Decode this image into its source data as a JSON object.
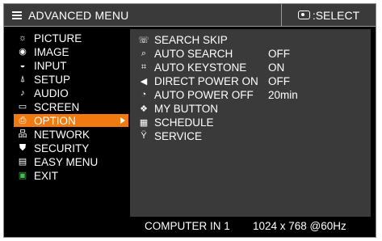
{
  "header": {
    "title": "ADVANCED MENU",
    "select_hint": ":SELECT"
  },
  "left_menu": [
    {
      "label": "PICTURE",
      "icon": "picture-icon",
      "active": false
    },
    {
      "label": "IMAGE",
      "icon": "image-icon",
      "active": false
    },
    {
      "label": "INPUT",
      "icon": "input-icon",
      "active": false
    },
    {
      "label": "SETUP",
      "icon": "setup-icon",
      "active": false
    },
    {
      "label": "AUDIO",
      "icon": "audio-icon",
      "active": false
    },
    {
      "label": "SCREEN",
      "icon": "screen-icon",
      "active": false
    },
    {
      "label": "OPTION",
      "icon": "option-icon",
      "active": true
    },
    {
      "label": "NETWORK",
      "icon": "network-icon",
      "active": false
    },
    {
      "label": "SECURITY",
      "icon": "security-icon",
      "active": false
    },
    {
      "label": "EASY MENU",
      "icon": "easy-menu-icon",
      "active": false
    },
    {
      "label": "EXIT",
      "icon": "exit-icon",
      "active": false
    }
  ],
  "option_items": [
    {
      "label": "SEARCH SKIP",
      "value": "",
      "icon": "search-skip-icon"
    },
    {
      "label": "AUTO SEARCH",
      "value": "OFF",
      "icon": "auto-search-icon"
    },
    {
      "label": "AUTO KEYSTONE",
      "value": "ON",
      "icon": "auto-keystone-icon"
    },
    {
      "label": "DIRECT POWER ON",
      "value": "OFF",
      "icon": "direct-power-on-icon"
    },
    {
      "label": "AUTO POWER OFF",
      "value": "20min",
      "icon": "auto-power-off-icon"
    },
    {
      "label": "MY BUTTON",
      "value": "",
      "icon": "my-button-icon"
    },
    {
      "label": "SCHEDULE",
      "value": "",
      "icon": "schedule-icon"
    },
    {
      "label": "SERVICE",
      "value": "",
      "icon": "service-icon"
    }
  ],
  "status": {
    "input": "COMPUTER IN 1",
    "resolution": "1024 x 768 @60Hz"
  },
  "colors": {
    "highlight": "#f07a10",
    "background": "#000000",
    "panel": "#3a3a3a"
  }
}
